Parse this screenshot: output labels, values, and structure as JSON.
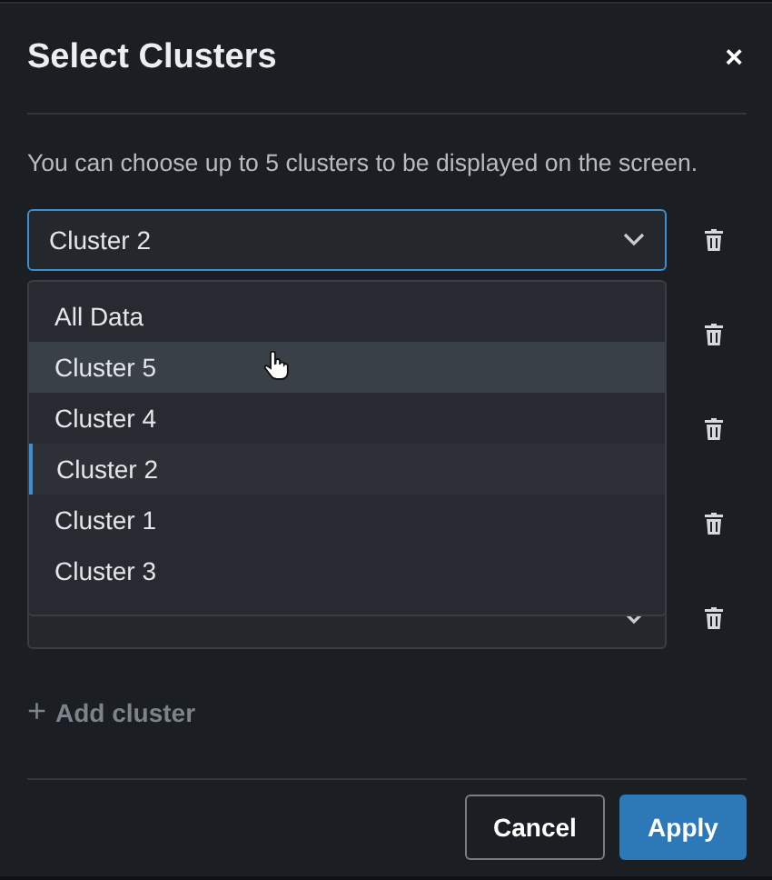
{
  "dialog": {
    "title": "Select Clusters",
    "close": "×"
  },
  "description": "You can choose up to 5 clusters to be displayed on the screen.",
  "open_select": {
    "value": "Cluster 2"
  },
  "covered_selects": [
    {
      "kind": "covered"
    },
    {
      "kind": "covered"
    },
    {
      "kind": "covered"
    },
    {
      "kind": "select"
    }
  ],
  "dropdown_options": [
    {
      "label": "All Data",
      "selected": false,
      "hovered": false
    },
    {
      "label": "Cluster 5",
      "selected": false,
      "hovered": true
    },
    {
      "label": "Cluster 4",
      "selected": false,
      "hovered": false
    },
    {
      "label": "Cluster 2",
      "selected": true,
      "hovered": false
    },
    {
      "label": "Cluster 1",
      "selected": false,
      "hovered": false
    },
    {
      "label": "Cluster 3",
      "selected": false,
      "hovered": false
    }
  ],
  "add_cluster": {
    "icon": "+",
    "label": "Add cluster"
  },
  "buttons": [
    {
      "label": "Cancel",
      "kind": "secondary"
    },
    {
      "label": "Apply",
      "kind": "primary"
    }
  ]
}
